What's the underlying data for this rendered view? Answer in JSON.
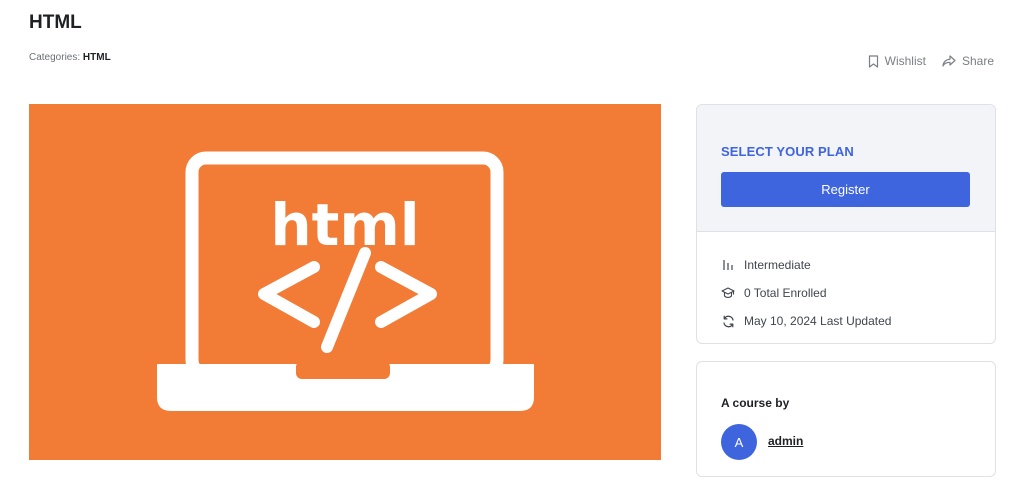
{
  "course": {
    "title": "HTML",
    "categories_label": "Categories:",
    "category": "HTML"
  },
  "actions": {
    "wishlist_label": "Wishlist",
    "share_label": "Share",
    "wishlist_icon": "bookmark-icon",
    "share_icon": "share-icon"
  },
  "hero": {
    "text": "html",
    "code_symbol": "</>",
    "background": "#f27b35"
  },
  "plan": {
    "title": "SELECT YOUR PLAN",
    "register_label": "Register"
  },
  "meta": {
    "items": [
      {
        "icon": "level-icon",
        "text": "Intermediate"
      },
      {
        "icon": "graduation-cap-icon",
        "text": "0 Total Enrolled"
      },
      {
        "icon": "refresh-icon",
        "text": "May 10, 2024 Last Updated"
      }
    ]
  },
  "author": {
    "by_label": "A course by",
    "avatar_initial": "A",
    "name": "admin"
  },
  "colors": {
    "accent": "#3e64de",
    "hero_orange": "#f27b35"
  }
}
